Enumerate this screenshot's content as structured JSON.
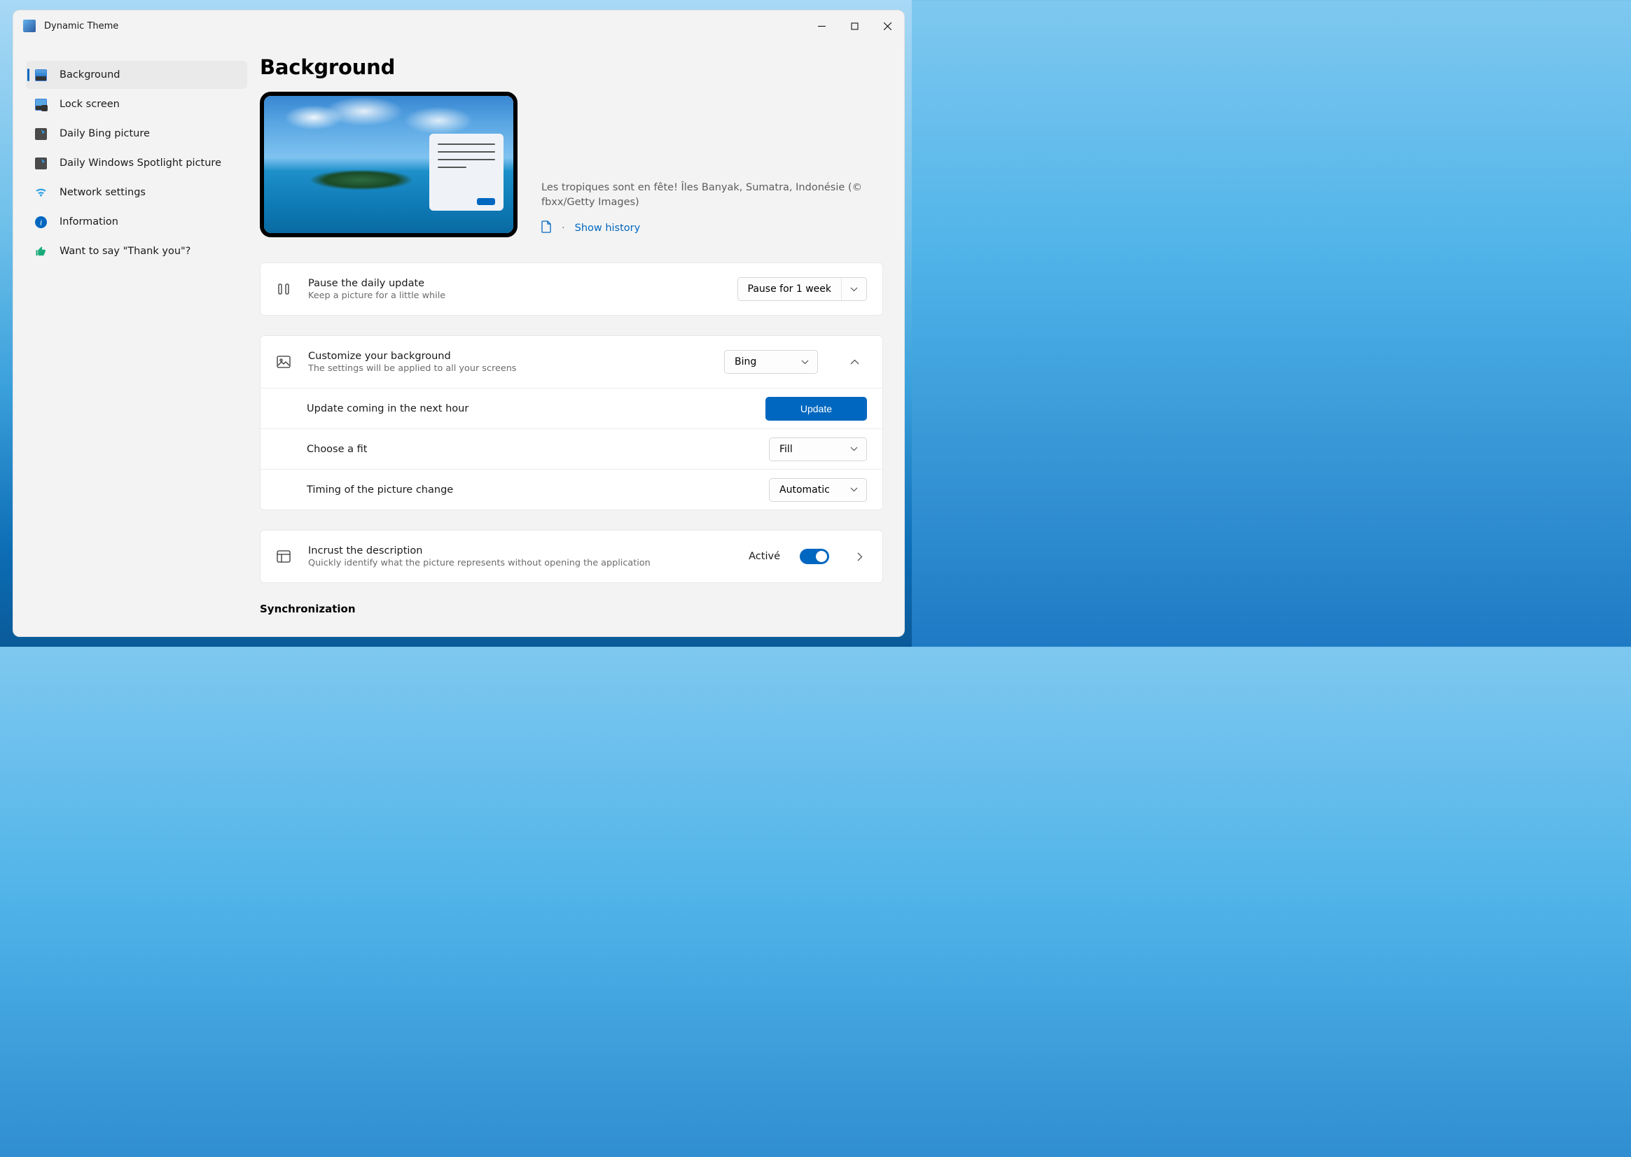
{
  "app": {
    "title": "Dynamic Theme"
  },
  "sidebar": {
    "items": [
      {
        "label": "Background",
        "active": true
      },
      {
        "label": "Lock screen"
      },
      {
        "label": "Daily Bing picture"
      },
      {
        "label": "Daily Windows Spotlight picture"
      },
      {
        "label": "Network settings"
      },
      {
        "label": "Information"
      },
      {
        "label": "Want to say \"Thank you\"?"
      }
    ]
  },
  "page": {
    "title": "Background",
    "preview_caption": "Les tropiques sont en fête! Îles Banyak, Sumatra, Indonésie (© fbxx/Getty Images)",
    "show_history": "Show history"
  },
  "pause": {
    "title": "Pause the daily update",
    "subtitle": "Keep a picture for a little while",
    "dropdown_value": "Pause for 1 week"
  },
  "customize": {
    "title": "Customize your background",
    "subtitle": "The settings will be applied to all your screens",
    "source_value": "Bing",
    "update_text": "Update coming in the next hour",
    "update_button": "Update",
    "fit_label": "Choose a fit",
    "fit_value": "Fill",
    "timing_label": "Timing of the picture change",
    "timing_value": "Automatic"
  },
  "incrust": {
    "title": "Incrust the description",
    "subtitle": "Quickly identify what the picture represents without opening the application",
    "state": "Activé"
  },
  "sync": {
    "heading": "Synchronization"
  }
}
